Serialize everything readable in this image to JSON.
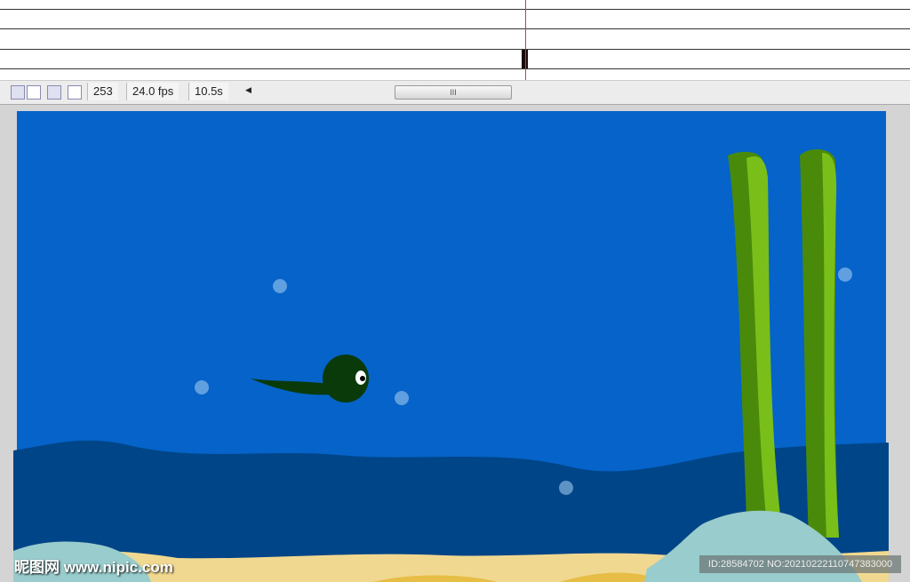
{
  "timeline": {
    "current_frame": "253",
    "frame_rate": "24.0 fps",
    "elapsed_time": "10.5s"
  },
  "icons": [
    "onion-skin-icon",
    "onion-skin-outlines-icon",
    "edit-multiple-frames-icon",
    "modify-onion-markers-icon",
    "scroll-left-icon"
  ],
  "scrollbar_grip": "III",
  "colors": {
    "water": "#0563c9",
    "deep_water": "#004587",
    "sand": "#f0d890",
    "rock": "#99cccc",
    "seaweed_dark": "#4a8a0a",
    "seaweed_light": "#7abe1a",
    "tadpole": "#0a3a0a"
  },
  "watermark": {
    "left": "昵图网 www.nipic.com",
    "right": "ID:28584702 NO:20210222110747383000"
  }
}
